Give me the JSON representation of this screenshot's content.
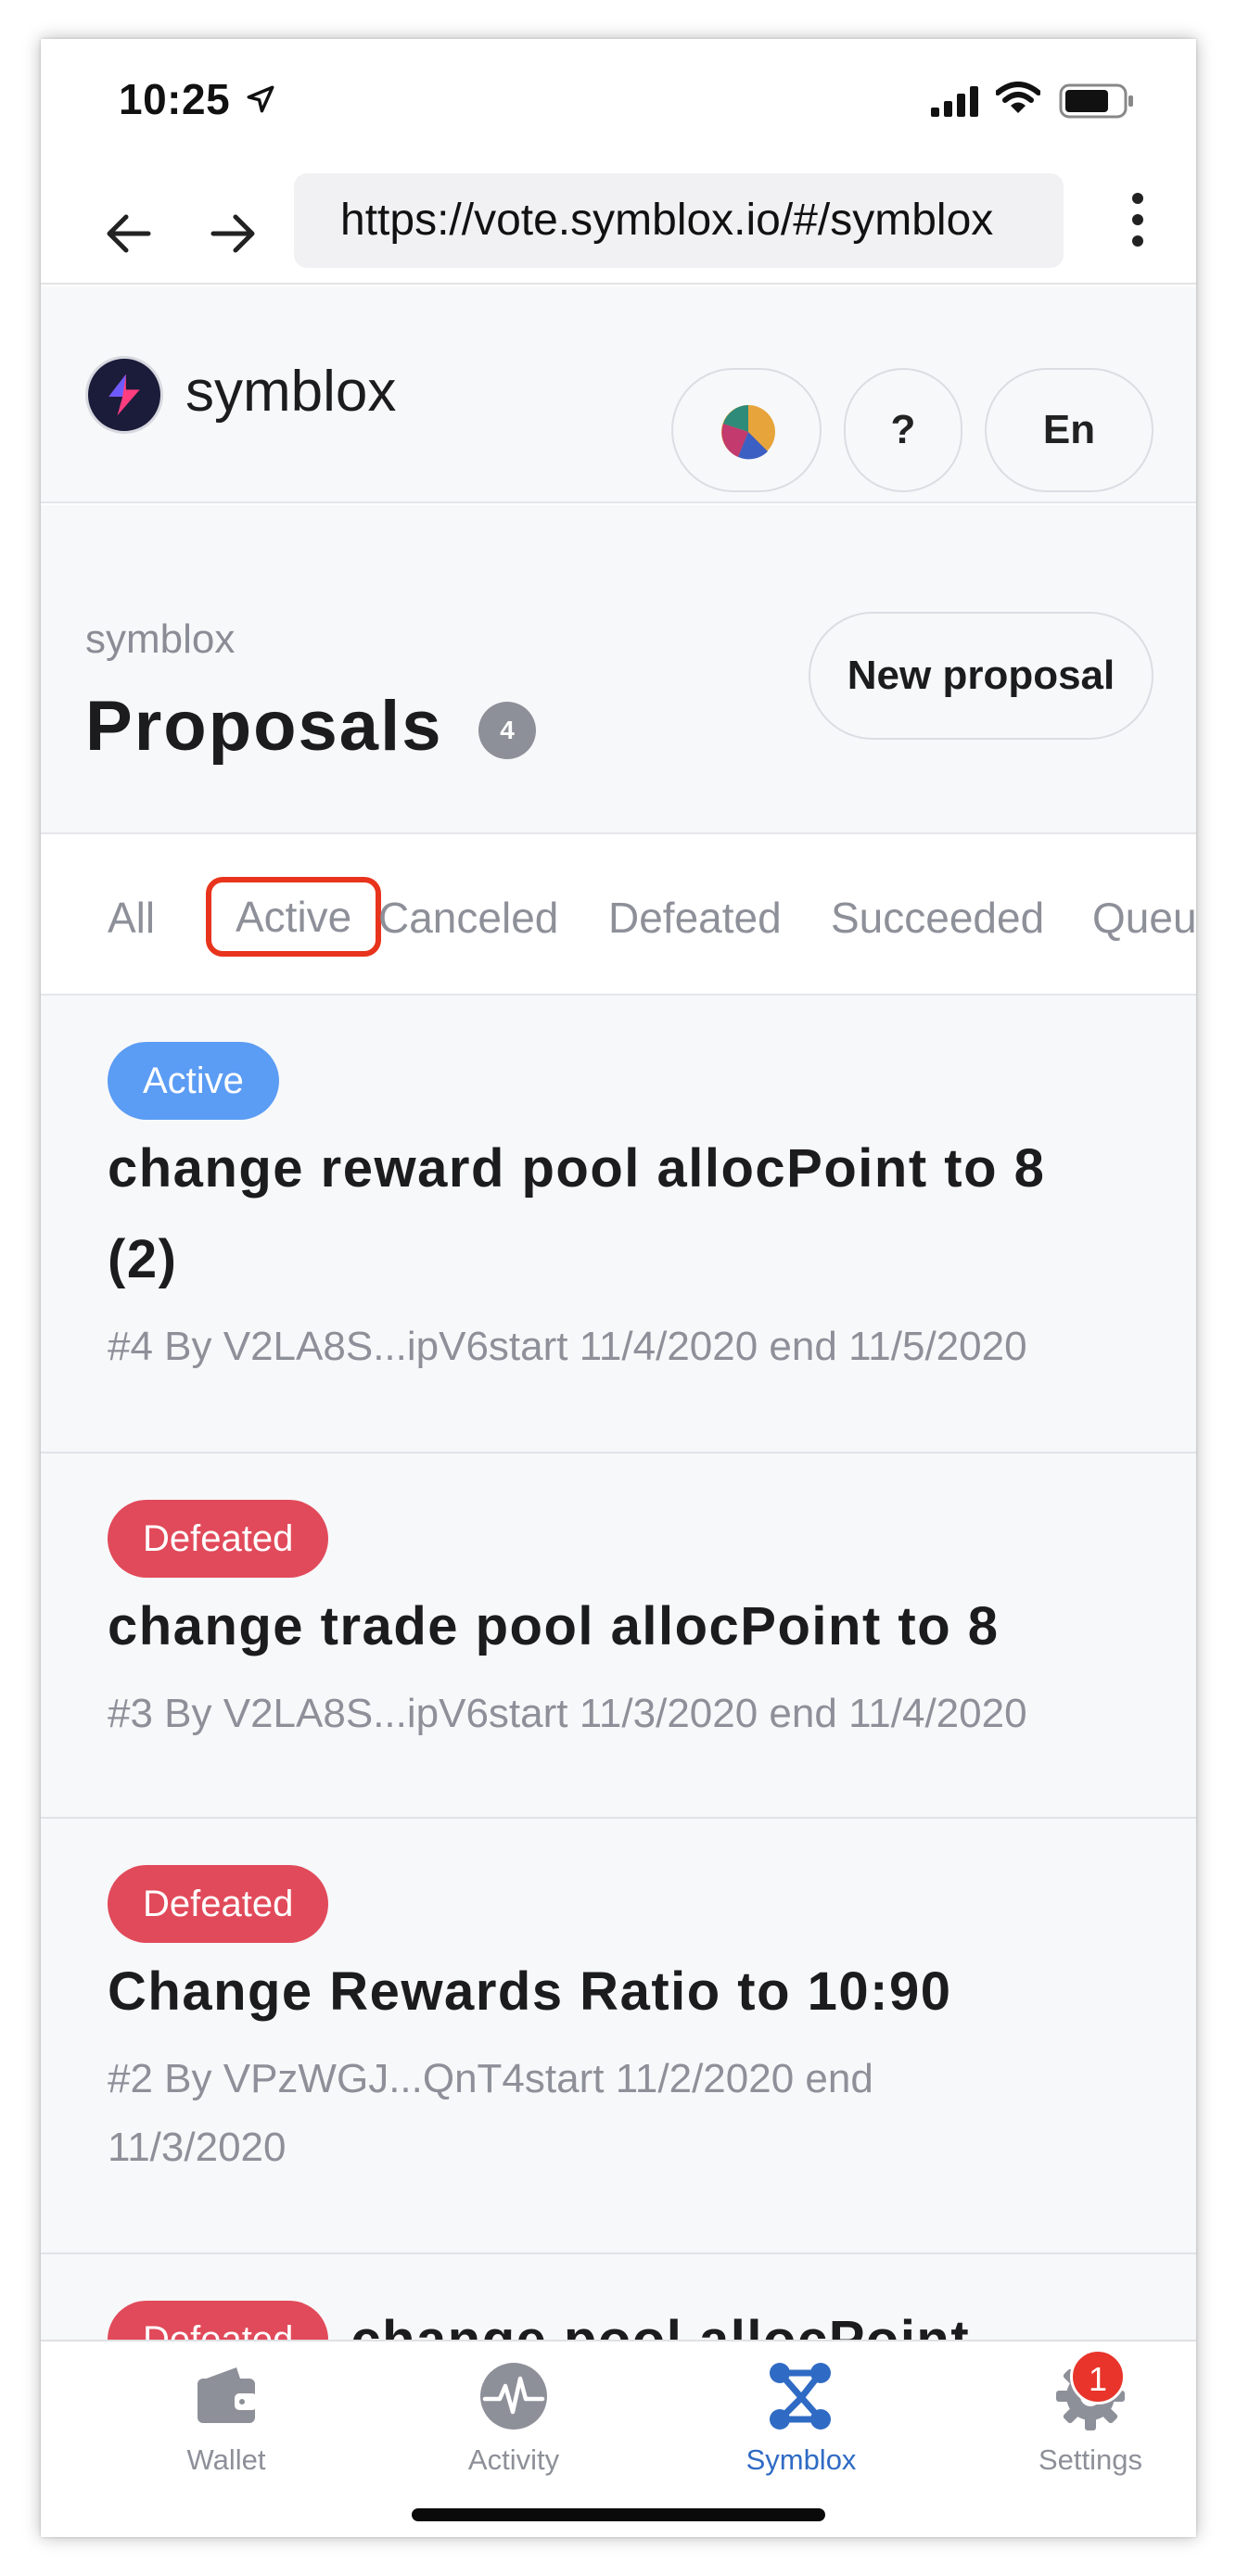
{
  "status_bar": {
    "time": "10:25"
  },
  "browser": {
    "url": "https://vote.symblox.io/#/symblox"
  },
  "app_header": {
    "brand": "symblox",
    "help_label": "?",
    "lang_label": "En"
  },
  "proposals": {
    "subtitle": "symblox",
    "title": "Proposals",
    "count": "4",
    "new_proposal_label": "New proposal"
  },
  "tabs": [
    "All",
    "Active",
    "Canceled",
    "Defeated",
    "Succeeded",
    "Queu"
  ],
  "items": [
    {
      "status": "Active",
      "title": "change reward pool allocPoint to 8 (2)",
      "meta": "#4 By V2LA8S...ipV6start 11/4/2020 end 11/5/2020"
    },
    {
      "status": "Defeated",
      "title": "change trade pool allocPoint to 8",
      "meta": "#3 By V2LA8S...ipV6start 11/3/2020 end 11/4/2020"
    },
    {
      "status": "Defeated",
      "title": "Change Rewards Ratio to 10:90",
      "meta": "#2 By VPzWGJ...QnT4start 11/2/2020 end 11/3/2020"
    },
    {
      "status": "Defeated",
      "title": "change pool allocPoint"
    }
  ],
  "bottom_nav": {
    "wallet": "Wallet",
    "activity": "Activity",
    "symblox": "Symblox",
    "settings": "Settings",
    "settings_badge": "1"
  },
  "colors": {
    "accent": "#2f6bc4",
    "active_badge": "#5b9cf4",
    "defeated_badge": "#e14a5a",
    "highlight": "#e8341c"
  }
}
